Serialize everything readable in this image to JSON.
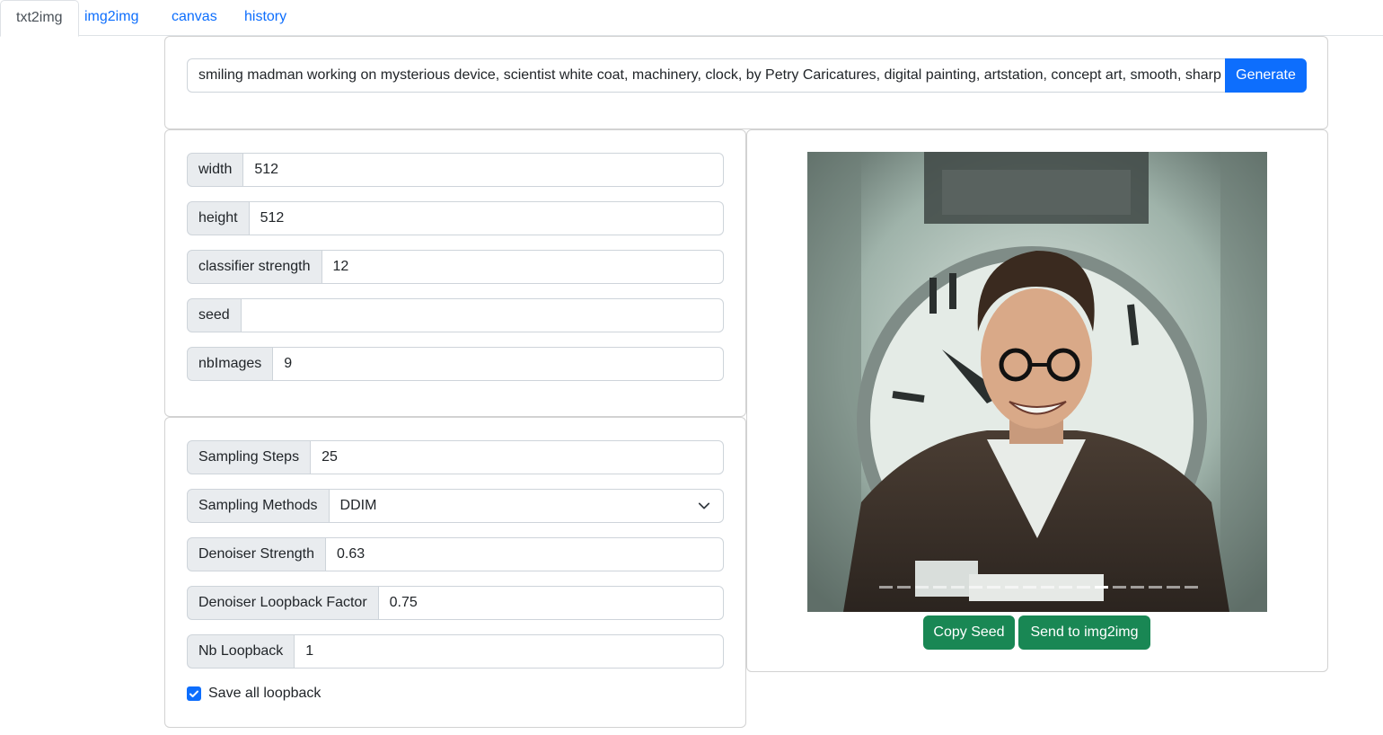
{
  "tabs": [
    {
      "label": "txt2img",
      "active": true
    },
    {
      "label": "img2img",
      "active": false
    },
    {
      "label": "canvas",
      "active": false
    },
    {
      "label": "history",
      "active": false
    }
  ],
  "prompt": {
    "value": "smiling madman working on mysterious device, scientist white coat, machinery, clock, by Petry Caricatures, digital painting, artstation, concept art, smooth, sharp",
    "generate_label": "Generate"
  },
  "params": [
    {
      "label": "width",
      "value": "512"
    },
    {
      "label": "height",
      "value": "512"
    },
    {
      "label": "classifier strength",
      "value": "12"
    },
    {
      "label": "seed",
      "value": ""
    },
    {
      "label": "nbImages",
      "value": "9"
    }
  ],
  "sampling": [
    {
      "label": "Sampling Steps",
      "value": "25"
    },
    {
      "label": "Sampling Methods",
      "value": "DDIM",
      "select": true
    },
    {
      "label": "Denoiser Strength",
      "value": "0.63"
    },
    {
      "label": "Denoiser Loopback Factor",
      "value": "0.75"
    },
    {
      "label": "Nb Loopback",
      "value": "1"
    }
  ],
  "save_loopback": {
    "label": "Save all loopback",
    "checked": true
  },
  "result": {
    "carousel_count": 18,
    "carousel_active_index": 12,
    "copy_seed_label": "Copy Seed",
    "send_label": "Send to img2img"
  },
  "colors": {
    "primary": "#0d6efd",
    "success": "#198754"
  }
}
